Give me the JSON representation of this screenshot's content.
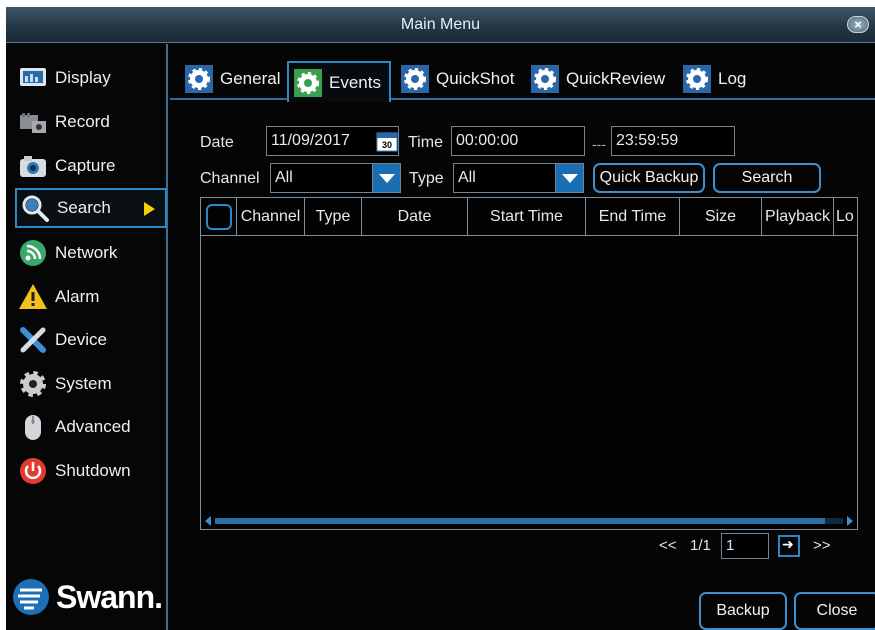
{
  "window": {
    "title": "Main Menu",
    "close_label": "×"
  },
  "sidebar": {
    "items": [
      {
        "label": "Display",
        "icon": "display-icon"
      },
      {
        "label": "Record",
        "icon": "record-icon"
      },
      {
        "label": "Capture",
        "icon": "camera-icon"
      },
      {
        "label": "Search",
        "icon": "search-icon",
        "active": true
      },
      {
        "label": "Network",
        "icon": "network-icon"
      },
      {
        "label": "Alarm",
        "icon": "alarm-icon"
      },
      {
        "label": "Device",
        "icon": "device-icon"
      },
      {
        "label": "System",
        "icon": "gear-icon"
      },
      {
        "label": "Advanced",
        "icon": "mouse-icon"
      },
      {
        "label": "Shutdown",
        "icon": "power-icon"
      }
    ],
    "logo_text": "Swann."
  },
  "tabs": [
    {
      "label": "General",
      "active": false
    },
    {
      "label": "Events",
      "active": true
    },
    {
      "label": "QuickShot",
      "active": false
    },
    {
      "label": "QuickReview",
      "active": false
    },
    {
      "label": "Log",
      "active": false
    }
  ],
  "filters": {
    "date_label": "Date",
    "date_value": "11/09/2017",
    "calendar_day": "30",
    "time_label": "Time",
    "time_start": "00:00:00",
    "time_separator": "---",
    "time_end": "23:59:59",
    "channel_label": "Channel",
    "channel_value": "All",
    "type_label": "Type",
    "type_value": "All",
    "quick_backup_label": "Quick Backup",
    "search_label": "Search"
  },
  "table": {
    "columns": [
      "Channel",
      "Type",
      "Date",
      "Start Time",
      "End Time",
      "Size",
      "Playback",
      "Lo"
    ]
  },
  "pager": {
    "prev_label": "<<",
    "page_info": "1/1",
    "page_input": "1",
    "next_label": ">>"
  },
  "footer": {
    "backup_label": "Backup",
    "close_label": "Close"
  },
  "colors": {
    "accent": "#2f86c4",
    "dropdown": "#1c6eb3",
    "highlight_arrow": "#f3d300"
  }
}
